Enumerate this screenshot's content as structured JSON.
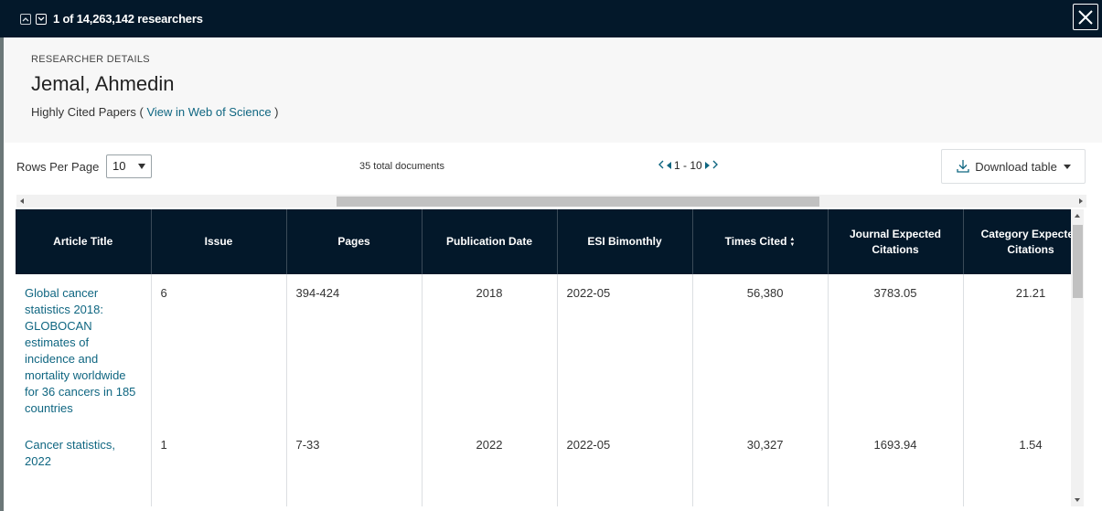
{
  "top_bar": {
    "counter_text": "1 of 14,263,142 researchers"
  },
  "details": {
    "kicker": "RESEARCHER DETAILS",
    "name": "Jemal, Ahmedin",
    "subtitle_prefix": "Highly Cited Papers (",
    "subtitle_link": "View in Web of Science",
    "subtitle_suffix": ")"
  },
  "controls": {
    "rows_per_page_label": "Rows Per Page",
    "rows_per_page_value": "10",
    "total_documents": "35 total documents",
    "page_range": "1 - 10",
    "download_label": "Download table"
  },
  "table": {
    "columns": [
      {
        "label": "Article Title"
      },
      {
        "label": "Issue"
      },
      {
        "label": "Pages"
      },
      {
        "label": "Publication Date"
      },
      {
        "label": "ESI Bimonthly"
      },
      {
        "label": "Times Cited"
      },
      {
        "label": "Journal Expected Citations"
      },
      {
        "label": "Category Expected Citations"
      }
    ],
    "rows": [
      {
        "title": "Global cancer statistics 2018: GLOBOCAN estimates of incidence and mortality worldwide for 36 cancers in 185 countries",
        "issue": "6",
        "pages": "394-424",
        "pub_date": "2018",
        "esi": "2022-05",
        "times_cited": "56,380",
        "journal_expected": "3783.05",
        "category_expected": "21.21"
      },
      {
        "title": "Cancer statistics, 2022",
        "issue": "1",
        "pages": "7-33",
        "pub_date": "2022",
        "esi": "2022-05",
        "times_cited": "30,327",
        "journal_expected": "1693.94",
        "category_expected": "1.54"
      }
    ]
  },
  "colors": {
    "header_bg": "#03182a",
    "link": "#0f6681",
    "details_bg": "#f7f7f7"
  },
  "icons": {
    "prev": "chevron-up-icon",
    "next": "chevron-down-icon",
    "close": "close-icon",
    "download": "download-icon",
    "sort": "sort-icon"
  }
}
